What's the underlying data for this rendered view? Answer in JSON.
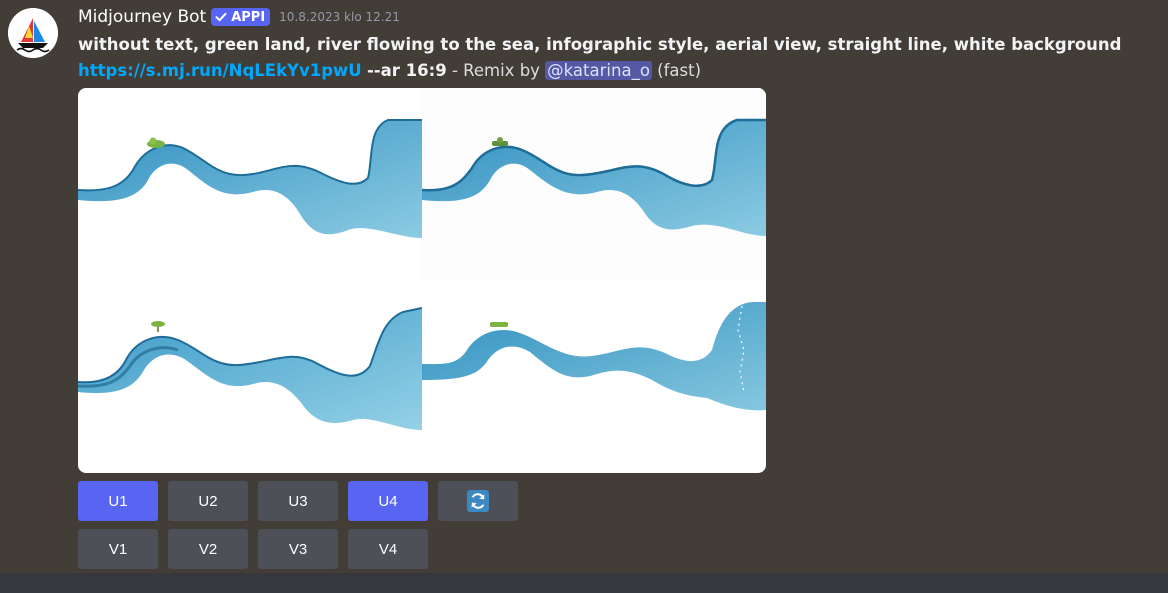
{
  "message": {
    "username": "Midjourney Bot",
    "badge": "APPI",
    "timestamp": "10.8.2023 klo 12.21",
    "prompt": "without text, green land, river flowing to the sea, infographic style, aerial view, straight line, white background",
    "link": "https://s.mj.run/NqLEkYv1pwU",
    "params": "--ar 16:9",
    "remix_text": " - Remix by ",
    "mention": "@katarina_o",
    "speed": "(fast)"
  },
  "buttons": {
    "row1": [
      "U1",
      "U2",
      "U3",
      "U4"
    ],
    "row1_active": [
      true,
      false,
      false,
      true
    ],
    "reroll_icon": "refresh-icon",
    "row2": [
      "V1",
      "V2",
      "V3",
      "V4"
    ]
  },
  "colors": {
    "accent": "#5865f2",
    "button": "#4e5058",
    "link": "#00a8fc",
    "background": "#433d37",
    "river": "#4aa6cf",
    "land": "#7cb342"
  }
}
